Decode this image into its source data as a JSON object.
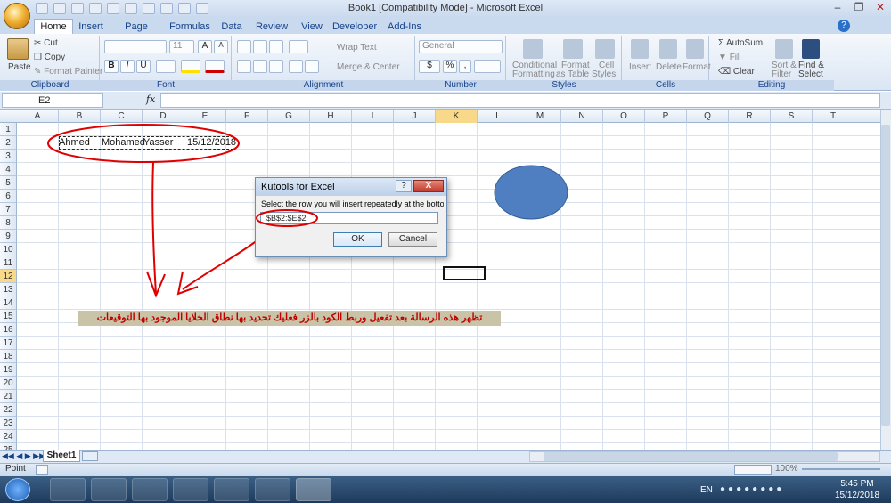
{
  "window": {
    "title": "Book1  [Compatibility Mode] - Microsoft Excel"
  },
  "tabs": [
    "Home",
    "Insert",
    "Page Layout",
    "Formulas",
    "Data",
    "Review",
    "View",
    "Developer",
    "Add-Ins"
  ],
  "ribbon": {
    "clipboard": {
      "paste": "Paste",
      "cut": "Cut",
      "copy": "Copy",
      "format_painter": "Format Painter",
      "label": "Clipboard"
    },
    "font": {
      "size": "11",
      "label": "Font",
      "bold": "B",
      "italic": "I",
      "underline": "U",
      "grow": "A",
      "shrink": "A"
    },
    "alignment": {
      "wrap": "Wrap Text",
      "merge": "Merge & Center",
      "label": "Alignment"
    },
    "number": {
      "format": "General",
      "currency": "$",
      "percent": "%",
      "comma": ",",
      "label": "Number"
    },
    "styles": {
      "conditional1": "Conditional",
      "conditional2": "Formatting",
      "format_table1": "Format",
      "format_table2": "as Table",
      "cell_styles1": "Cell",
      "cell_styles2": "Styles",
      "label": "Styles"
    },
    "cells": {
      "insert": "Insert",
      "delete": "Delete",
      "format": "Format",
      "label": "Cells"
    },
    "editing": {
      "autosum": "AutoSum",
      "fill": "Fill",
      "clear": "Clear",
      "sort1": "Sort &",
      "sort2": "Filter",
      "find1": "Find &",
      "find2": "Select",
      "label": "Editing"
    }
  },
  "formula_bar": {
    "name_box": "E2",
    "fx": "fx",
    "value": ""
  },
  "columns": [
    "A",
    "B",
    "C",
    "D",
    "E",
    "F",
    "G",
    "H",
    "I",
    "J",
    "K",
    "L",
    "M",
    "N",
    "O",
    "P",
    "Q",
    "R",
    "S",
    "T"
  ],
  "rows": [
    "1",
    "2",
    "3",
    "4",
    "5",
    "6",
    "7",
    "8",
    "9",
    "10",
    "11",
    "12",
    "13",
    "14",
    "15",
    "16",
    "17",
    "18",
    "19",
    "20",
    "21",
    "22",
    "23",
    "24",
    "25"
  ],
  "cells": {
    "B2": "Ahmed",
    "C2": "Mohamed",
    "D2": "Yasser",
    "E2": "15/12/2018"
  },
  "dialog": {
    "title": "Kutools for Excel",
    "help": "?",
    "close": "X",
    "prompt": "Select the row you will insert repeatedly at the bottom:",
    "range": "$B$2:$E$2",
    "ok": "OK",
    "cancel": "Cancel"
  },
  "annotation": "تظهر هذه الرسالة بعد تفعيل وربط الكود بالزر فعليك تحديد بها نطاق الخلايا الموجود بها التوقيعات",
  "sheet_tabs": [
    "Sheet1"
  ],
  "status": {
    "mode": "Point",
    "zoom": "100%"
  },
  "taskbar": {
    "lang": "EN",
    "time": "5:45 PM",
    "date": "15/12/2018"
  },
  "colors": {
    "accent": "#15428b",
    "annotation_red": "#e00000",
    "shape_fill": "#4f7fc0"
  }
}
